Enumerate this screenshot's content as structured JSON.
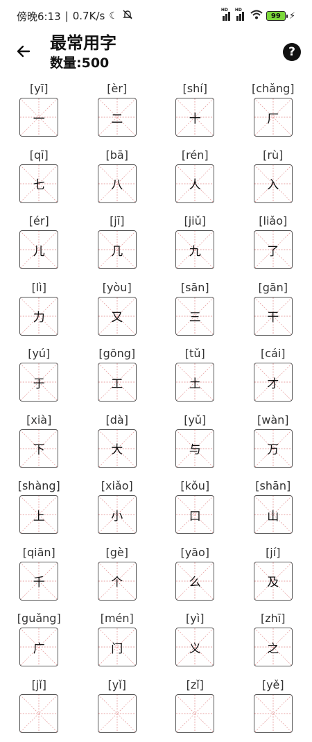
{
  "status": {
    "time": "傍晚6:13",
    "speed": "0.7K/s",
    "battery": "99"
  },
  "header": {
    "title": "最常用字",
    "count": "数量:500",
    "help_label": "?"
  },
  "chars": [
    {
      "py": "[yī]",
      "hz": "一"
    },
    {
      "py": "[èr]",
      "hz": "二"
    },
    {
      "py": "[shí]",
      "hz": "十"
    },
    {
      "py": "[chǎng]",
      "hz": "厂"
    },
    {
      "py": "[qī]",
      "hz": "七"
    },
    {
      "py": "[bā]",
      "hz": "八"
    },
    {
      "py": "[rén]",
      "hz": "人"
    },
    {
      "py": "[rù]",
      "hz": "入"
    },
    {
      "py": "[ér]",
      "hz": "儿"
    },
    {
      "py": "[jī]",
      "hz": "几"
    },
    {
      "py": "[jiǔ]",
      "hz": "九"
    },
    {
      "py": "[liǎo]",
      "hz": "了"
    },
    {
      "py": "[lì]",
      "hz": "力"
    },
    {
      "py": "[yòu]",
      "hz": "又"
    },
    {
      "py": "[sān]",
      "hz": "三"
    },
    {
      "py": "[gān]",
      "hz": "干"
    },
    {
      "py": "[yú]",
      "hz": "于"
    },
    {
      "py": "[gōng]",
      "hz": "工"
    },
    {
      "py": "[tǔ]",
      "hz": "土"
    },
    {
      "py": "[cái]",
      "hz": "才"
    },
    {
      "py": "[xià]",
      "hz": "下"
    },
    {
      "py": "[dà]",
      "hz": "大"
    },
    {
      "py": "[yǔ]",
      "hz": "与"
    },
    {
      "py": "[wàn]",
      "hz": "万"
    },
    {
      "py": "[shàng]",
      "hz": "上"
    },
    {
      "py": "[xiǎo]",
      "hz": "小"
    },
    {
      "py": "[kǒu]",
      "hz": "口"
    },
    {
      "py": "[shān]",
      "hz": "山"
    },
    {
      "py": "[qiān]",
      "hz": "千"
    },
    {
      "py": "[gè]",
      "hz": "个"
    },
    {
      "py": "[yāo]",
      "hz": "么"
    },
    {
      "py": "[jí]",
      "hz": "及"
    },
    {
      "py": "[guǎng]",
      "hz": "广"
    },
    {
      "py": "[mén]",
      "hz": "门"
    },
    {
      "py": "[yì]",
      "hz": "义"
    },
    {
      "py": "[zhī]",
      "hz": "之"
    },
    {
      "py": "[jǐ]",
      "hz": ""
    },
    {
      "py": "[yǐ]",
      "hz": ""
    },
    {
      "py": "[zǐ]",
      "hz": ""
    },
    {
      "py": "[yě]",
      "hz": ""
    }
  ],
  "colors": {
    "guide_line": "#e7a0a0",
    "battery_fill": "#7cd83b"
  }
}
